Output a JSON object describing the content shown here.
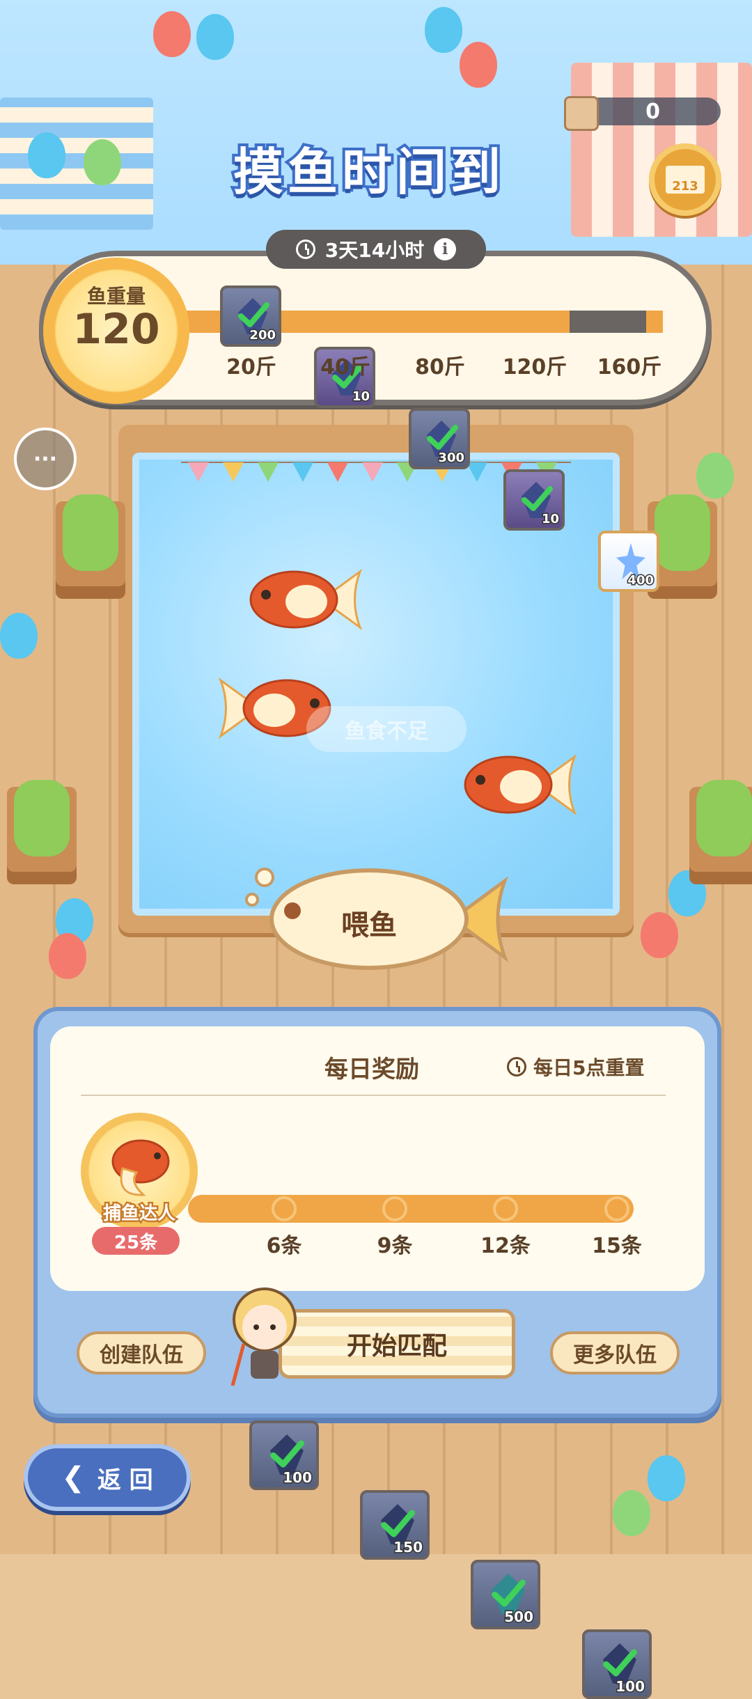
{
  "title": "摸鱼时间到",
  "currency": {
    "value": "0"
  },
  "timer": {
    "text": "3天14小时",
    "info": "i"
  },
  "weight": {
    "label": "鱼重量",
    "value": "120"
  },
  "milestones": [
    {
      "label": "20斤",
      "qty": "200",
      "claimed": true
    },
    {
      "label": "40斤",
      "qty": "10",
      "claimed": true
    },
    {
      "label": "80斤",
      "qty": "300",
      "claimed": true
    },
    {
      "label": "120斤",
      "qty": "10",
      "claimed": true
    },
    {
      "label": "160斤",
      "qty": "400",
      "claimed": false
    }
  ],
  "chat": {
    "icon": "chat-bubble-icon",
    "glyph": "···"
  },
  "toast": "鱼食不足",
  "feed": {
    "label": "喂鱼"
  },
  "daily": {
    "title": "每日奖励",
    "reset": "每日5点重置",
    "badge_label": "捕鱼达人",
    "count": "25条",
    "rewards": [
      {
        "qty": "100",
        "label": "6条",
        "claimed": true
      },
      {
        "qty": "150",
        "label": "9条",
        "claimed": true
      },
      {
        "qty": "500",
        "label": "12条",
        "claimed": true
      },
      {
        "qty": "100",
        "label": "15条",
        "claimed": true
      }
    ]
  },
  "buttons": {
    "create_team": "创建队伍",
    "start_match": "开始匹配",
    "more_teams": "更多队伍",
    "back": "返 回"
  },
  "colors": {
    "accent_orange": "#f0a646",
    "title_blue": "#3d6fc9",
    "panel_blue": "#9fc3ea",
    "badge_red": "#e86b6b"
  }
}
